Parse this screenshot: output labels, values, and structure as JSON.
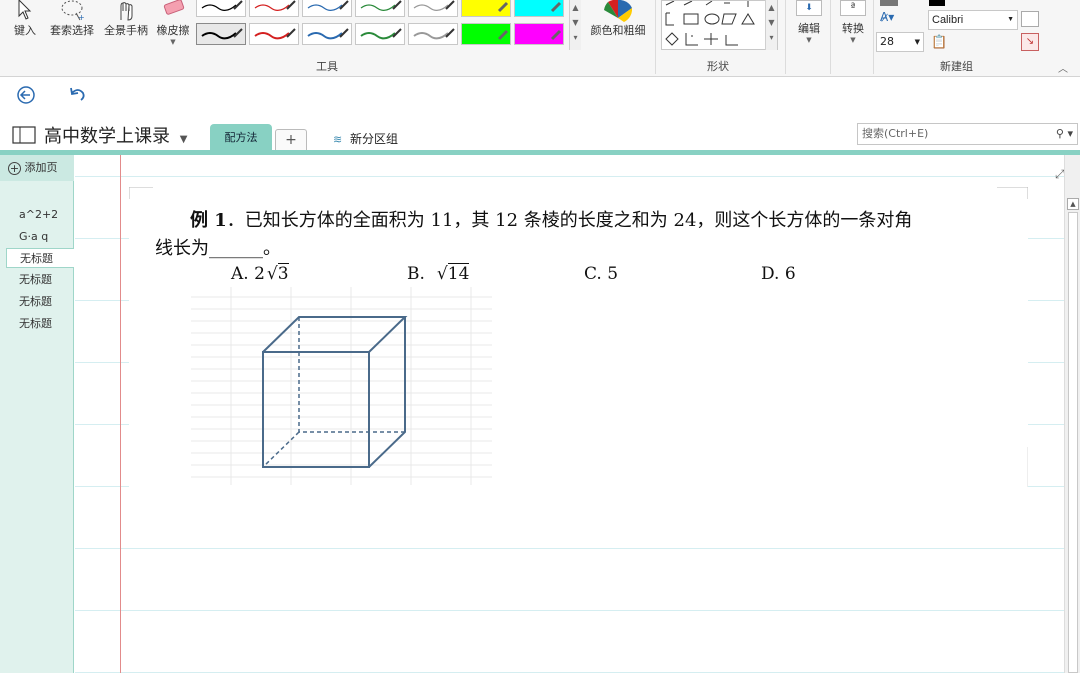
{
  "ribbon": {
    "tools": [
      {
        "label": "键入",
        "icon": "cursor-icon"
      },
      {
        "label": "套索选择",
        "icon": "lasso-icon"
      },
      {
        "label": "全景手柄",
        "icon": "hand-icon"
      },
      {
        "label": "橡皮擦",
        "icon": "eraser-icon"
      }
    ],
    "color_thickness_label": "颜色和粗细",
    "tools_group_label": "工具",
    "shapes_group_label": "形状",
    "edit_label": "编辑",
    "convert_label": "转换",
    "new_group_label": "新建组",
    "font_name": "Calibri",
    "font_size": "28",
    "pens_top": [
      "#000000",
      "#d42020",
      "#2a6ab0",
      "#2a8a3a",
      "#888888",
      "#ffff00",
      "#00ffff"
    ],
    "pens_bottom": [
      "#000000",
      "#d42020",
      "#2a6ab0",
      "#2a8a3a",
      "#888888",
      "#00ff00",
      "#ff00ff"
    ]
  },
  "notebook": {
    "title": "高中数学上课录",
    "section_tab": "配方法",
    "add_tab": "+",
    "section_group": "新分区组",
    "search_placeholder": "搜索(Ctrl+E)"
  },
  "pages": {
    "add_label": "添加页",
    "items": [
      "a^2+2",
      "G·a q",
      "无标题",
      "无标题",
      "无标题",
      "无标题"
    ],
    "selected_index": 2
  },
  "question": {
    "label": "例 1",
    "line1": "．已知长方体的全面积为 11，其 12 条棱的长度之和为 24，则这个长方体的一条对角",
    "line2": "线长为______。",
    "options": {
      "a_prefix": "A.  2",
      "a_radicand": "3",
      "b_prefix": "B.",
      "b_radicand": "14",
      "c": "C.  5",
      "d": "D.  6"
    }
  }
}
